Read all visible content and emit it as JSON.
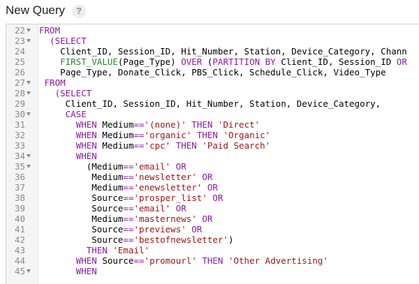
{
  "header": {
    "title": "New Query",
    "help_label": "?"
  },
  "editor": {
    "lines": [
      {
        "num": "22",
        "fold": true,
        "indent": 0,
        "tokens": [
          {
            "t": "kw",
            "v": "FROM"
          }
        ]
      },
      {
        "num": "23",
        "fold": true,
        "indent": 2,
        "tokens": [
          {
            "t": "kw",
            "v": "(SELECT"
          }
        ]
      },
      {
        "num": "24",
        "fold": false,
        "indent": 4,
        "tokens": [
          {
            "t": "pl",
            "v": "Client_ID, Session_ID, Hit_Number, Station, Device_Category, Chann"
          }
        ]
      },
      {
        "num": "25",
        "fold": false,
        "indent": 4,
        "tokens": [
          {
            "t": "fn",
            "v": "FIRST_VALUE"
          },
          {
            "t": "pl",
            "v": "(Page_Type) "
          },
          {
            "t": "kw",
            "v": "OVER"
          },
          {
            "t": "pl",
            "v": " ("
          },
          {
            "t": "kw",
            "v": "PARTITION BY"
          },
          {
            "t": "pl",
            "v": " Client_ID, Session_ID "
          },
          {
            "t": "kw",
            "v": "OR"
          }
        ]
      },
      {
        "num": "26",
        "fold": false,
        "indent": 4,
        "tokens": [
          {
            "t": "pl",
            "v": "Page_Type, Donate_Click, PBS_Click, Schedule_Click, Video_Type"
          }
        ]
      },
      {
        "num": "27",
        "fold": true,
        "indent": 1,
        "tokens": [
          {
            "t": "kw",
            "v": "FROM"
          }
        ]
      },
      {
        "num": "28",
        "fold": true,
        "indent": 3,
        "tokens": [
          {
            "t": "kw",
            "v": "(SELECT"
          }
        ]
      },
      {
        "num": "29",
        "fold": false,
        "indent": 5,
        "tokens": [
          {
            "t": "pl",
            "v": "Client_ID, Session_ID, Hit_Number, Station, Device_Category,"
          }
        ]
      },
      {
        "num": "30",
        "fold": true,
        "indent": 5,
        "tokens": [
          {
            "t": "kw",
            "v": "CASE"
          }
        ]
      },
      {
        "num": "31",
        "fold": false,
        "indent": 7,
        "tokens": [
          {
            "t": "kw",
            "v": "WHEN"
          },
          {
            "t": "pl",
            "v": " Medium"
          },
          {
            "t": "op",
            "v": "=="
          },
          {
            "t": "str",
            "v": "'(none)'"
          },
          {
            "t": "pl",
            "v": " "
          },
          {
            "t": "kw",
            "v": "THEN"
          },
          {
            "t": "pl",
            "v": " "
          },
          {
            "t": "str",
            "v": "'Direct'"
          }
        ]
      },
      {
        "num": "32",
        "fold": false,
        "indent": 7,
        "tokens": [
          {
            "t": "kw",
            "v": "WHEN"
          },
          {
            "t": "pl",
            "v": " Medium"
          },
          {
            "t": "op",
            "v": "=="
          },
          {
            "t": "str",
            "v": "'organic'"
          },
          {
            "t": "pl",
            "v": " "
          },
          {
            "t": "kw",
            "v": "THEN"
          },
          {
            "t": "pl",
            "v": " "
          },
          {
            "t": "str",
            "v": "'Organic'"
          }
        ]
      },
      {
        "num": "33",
        "fold": false,
        "indent": 7,
        "tokens": [
          {
            "t": "kw",
            "v": "WHEN"
          },
          {
            "t": "pl",
            "v": " Medium"
          },
          {
            "t": "op",
            "v": "=="
          },
          {
            "t": "str",
            "v": "'cpc'"
          },
          {
            "t": "pl",
            "v": " "
          },
          {
            "t": "kw",
            "v": "THEN"
          },
          {
            "t": "pl",
            "v": " "
          },
          {
            "t": "str",
            "v": "'Paid Search'"
          }
        ]
      },
      {
        "num": "34",
        "fold": true,
        "indent": 7,
        "tokens": [
          {
            "t": "kw",
            "v": "WHEN"
          }
        ]
      },
      {
        "num": "35",
        "fold": true,
        "indent": 9,
        "tokens": [
          {
            "t": "pl",
            "v": "(Medium"
          },
          {
            "t": "op",
            "v": "=="
          },
          {
            "t": "str",
            "v": "'email'"
          },
          {
            "t": "pl",
            "v": " "
          },
          {
            "t": "kw",
            "v": "OR"
          }
        ]
      },
      {
        "num": "36",
        "fold": false,
        "indent": 10,
        "tokens": [
          {
            "t": "pl",
            "v": "Medium"
          },
          {
            "t": "op",
            "v": "=="
          },
          {
            "t": "str",
            "v": "'newsletter'"
          },
          {
            "t": "pl",
            "v": " "
          },
          {
            "t": "kw",
            "v": "OR"
          }
        ]
      },
      {
        "num": "37",
        "fold": false,
        "indent": 10,
        "tokens": [
          {
            "t": "pl",
            "v": "Medium"
          },
          {
            "t": "op",
            "v": "=="
          },
          {
            "t": "str",
            "v": "'enewsletter'"
          },
          {
            "t": "pl",
            "v": " "
          },
          {
            "t": "kw",
            "v": "OR"
          }
        ]
      },
      {
        "num": "38",
        "fold": false,
        "indent": 10,
        "tokens": [
          {
            "t": "pl",
            "v": "Source"
          },
          {
            "t": "op",
            "v": "=="
          },
          {
            "t": "str",
            "v": "'prosper_list'"
          },
          {
            "t": "pl",
            "v": " "
          },
          {
            "t": "kw",
            "v": "OR"
          }
        ]
      },
      {
        "num": "39",
        "fold": false,
        "indent": 10,
        "tokens": [
          {
            "t": "pl",
            "v": "Source"
          },
          {
            "t": "op",
            "v": "=="
          },
          {
            "t": "str",
            "v": "'email'"
          },
          {
            "t": "pl",
            "v": " "
          },
          {
            "t": "kw",
            "v": "OR"
          }
        ]
      },
      {
        "num": "40",
        "fold": false,
        "indent": 10,
        "tokens": [
          {
            "t": "pl",
            "v": "Medium"
          },
          {
            "t": "op",
            "v": "=="
          },
          {
            "t": "str",
            "v": "'masternews'"
          },
          {
            "t": "pl",
            "v": " "
          },
          {
            "t": "kw",
            "v": "OR"
          }
        ]
      },
      {
        "num": "41",
        "fold": false,
        "indent": 10,
        "tokens": [
          {
            "t": "pl",
            "v": "Source"
          },
          {
            "t": "op",
            "v": "=="
          },
          {
            "t": "str",
            "v": "'previews'"
          },
          {
            "t": "pl",
            "v": " "
          },
          {
            "t": "kw",
            "v": "OR"
          }
        ]
      },
      {
        "num": "42",
        "fold": false,
        "indent": 10,
        "tokens": [
          {
            "t": "pl",
            "v": "Source"
          },
          {
            "t": "op",
            "v": "=="
          },
          {
            "t": "str",
            "v": "'bestofnewsletter'"
          },
          {
            "t": "pl",
            "v": ")"
          }
        ]
      },
      {
        "num": "43",
        "fold": false,
        "indent": 9,
        "tokens": [
          {
            "t": "kw",
            "v": "THEN"
          },
          {
            "t": "pl",
            "v": " "
          },
          {
            "t": "str",
            "v": "'Email'"
          }
        ]
      },
      {
        "num": "44",
        "fold": false,
        "indent": 7,
        "tokens": [
          {
            "t": "kw",
            "v": "WHEN"
          },
          {
            "t": "pl",
            "v": " Source"
          },
          {
            "t": "op",
            "v": "=="
          },
          {
            "t": "str",
            "v": "'promourl'"
          },
          {
            "t": "pl",
            "v": " "
          },
          {
            "t": "kw",
            "v": "THEN"
          },
          {
            "t": "pl",
            "v": " "
          },
          {
            "t": "str",
            "v": "'Other Advertising'"
          }
        ]
      },
      {
        "num": "45",
        "fold": true,
        "indent": 7,
        "tokens": [
          {
            "t": "kw",
            "v": "WHEN"
          }
        ]
      }
    ]
  }
}
